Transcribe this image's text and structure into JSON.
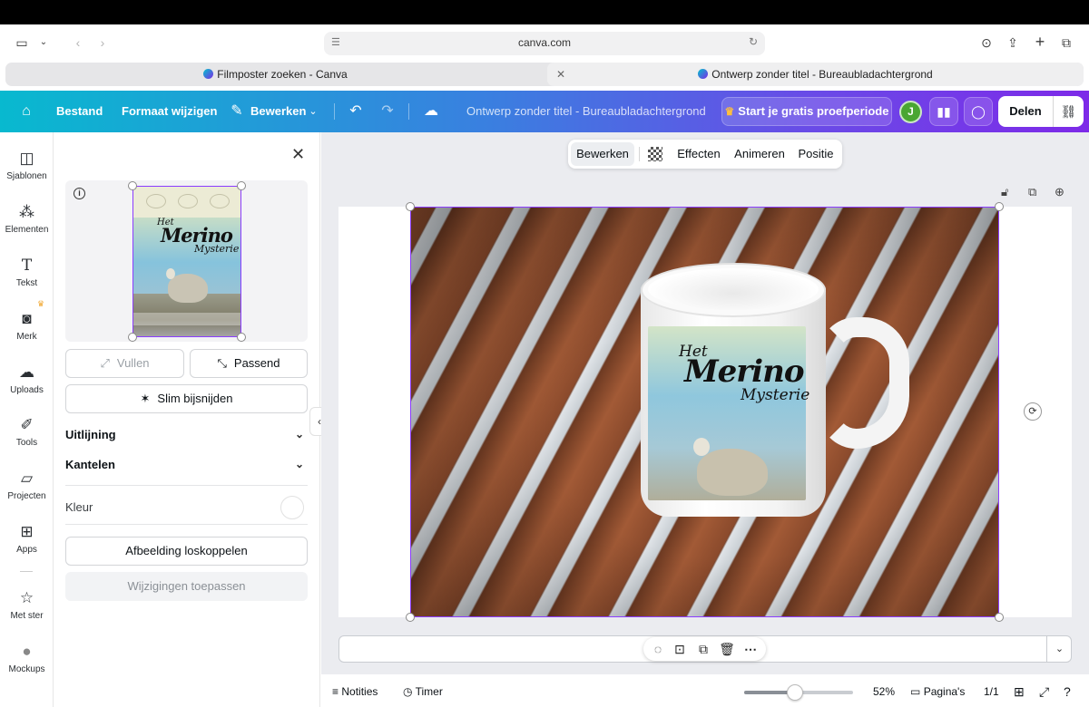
{
  "browser": {
    "url": "canva.com",
    "tabs": [
      {
        "label": "Filmposter zoeken - Canva"
      },
      {
        "label": "Ontwerp zonder titel - Bureaubladachtergrond"
      }
    ]
  },
  "header": {
    "home_icon": "home-icon",
    "file_label": "Bestand",
    "resize_label": "Formaat wijzigen",
    "edit_label": "Bewerken",
    "design_title": "Ontwerp zonder titel - Bureaubladachtergrond",
    "trial_label": "Start je gratis proefperiode",
    "avatar_initial": "J",
    "share_label": "Delen",
    "accent_start": "#08b9cf",
    "accent_end": "#7d2ae8"
  },
  "rail": {
    "items": [
      {
        "label": "Sjablonen"
      },
      {
        "label": "Elementen"
      },
      {
        "label": "Tekst"
      },
      {
        "label": "Merk"
      },
      {
        "label": "Uploads"
      },
      {
        "label": "Tools"
      },
      {
        "label": "Projecten"
      },
      {
        "label": "Apps"
      },
      {
        "label": "Met ster"
      },
      {
        "label": "Mockups"
      }
    ]
  },
  "panel": {
    "poster": {
      "line1": "Het",
      "line2": "Merino",
      "line3": "Mysterie"
    },
    "fill_label": "Vullen",
    "fit_label": "Passend",
    "smart_crop_label": "Slim bijsnijden",
    "align_label": "Uitlijning",
    "tilt_label": "Kantelen",
    "color_label": "Kleur",
    "detach_label": "Afbeelding loskoppelen",
    "apply_label": "Wijzigingen toepassen"
  },
  "canvas_toolbar": {
    "edit_label": "Bewerken",
    "effects_label": "Effecten",
    "animate_label": "Animeren",
    "position_label": "Positie"
  },
  "mug_print": {
    "line1": "Het",
    "line2": "Merino",
    "line3": "Mysterie"
  },
  "footer": {
    "notes_label": "Notities",
    "timer_label": "Timer",
    "zoom_value": 52,
    "zoom_label": "52%",
    "pages_label": "Pagina's",
    "page_count": "1/1"
  }
}
